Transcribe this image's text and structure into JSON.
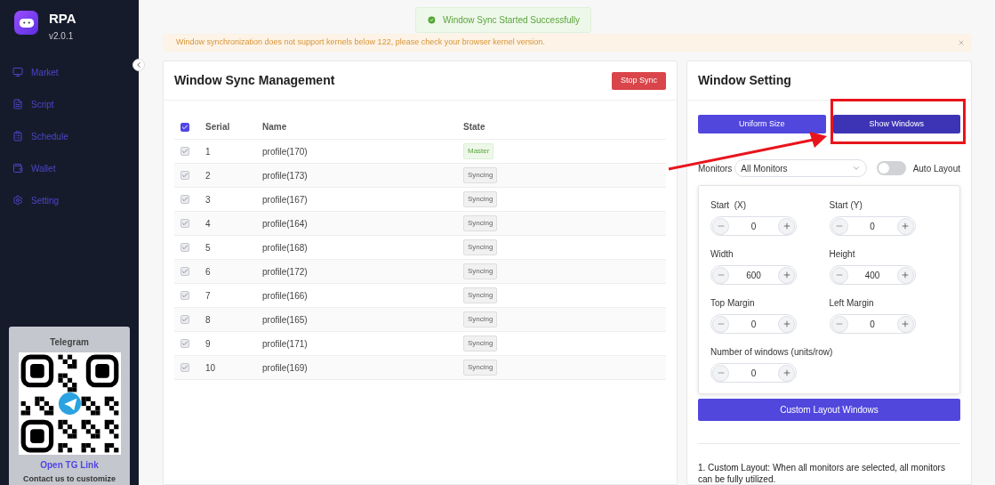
{
  "sidebar": {
    "app_name": "RPA",
    "version": "v2.0.1",
    "items": [
      {
        "label": "Market",
        "selected": false
      },
      {
        "label": "Script",
        "selected": false
      },
      {
        "label": "Schedule",
        "selected": false
      },
      {
        "label": "Wallet",
        "selected": false
      },
      {
        "label": "Setting",
        "selected": false
      }
    ],
    "promo": {
      "title": "Telegram",
      "link": "Open TG Link",
      "note": "Contact us to customize"
    }
  },
  "toast": {
    "text": "Window Sync Started Successfully"
  },
  "alert": {
    "text": "Window synchronization does not support kernels below 122, please check your browser kernel version."
  },
  "sync_panel": {
    "title": "Window Sync Management",
    "stop_button": "Stop Sync",
    "table": {
      "all_checked": true,
      "columns": [
        "Serial",
        "Name",
        "State"
      ],
      "rows": [
        {
          "serial": "1",
          "name": "profile(170)",
          "state": "Master",
          "kind": "master",
          "checked": true,
          "disabled": true
        },
        {
          "serial": "2",
          "name": "profile(173)",
          "state": "Syncing",
          "kind": "syncing",
          "checked": true,
          "disabled": true
        },
        {
          "serial": "3",
          "name": "profile(167)",
          "state": "Syncing",
          "kind": "syncing",
          "checked": true,
          "disabled": true
        },
        {
          "serial": "4",
          "name": "profile(164)",
          "state": "Syncing",
          "kind": "syncing",
          "checked": true,
          "disabled": true
        },
        {
          "serial": "5",
          "name": "profile(168)",
          "state": "Syncing",
          "kind": "syncing",
          "checked": true,
          "disabled": true
        },
        {
          "serial": "6",
          "name": "profile(172)",
          "state": "Syncing",
          "kind": "syncing",
          "checked": true,
          "disabled": true
        },
        {
          "serial": "7",
          "name": "profile(166)",
          "state": "Syncing",
          "kind": "syncing",
          "checked": true,
          "disabled": true
        },
        {
          "serial": "8",
          "name": "profile(165)",
          "state": "Syncing",
          "kind": "syncing",
          "checked": true,
          "disabled": true
        },
        {
          "serial": "9",
          "name": "profile(171)",
          "state": "Syncing",
          "kind": "syncing",
          "checked": true,
          "disabled": true
        },
        {
          "serial": "10",
          "name": "profile(169)",
          "state": "Syncing",
          "kind": "syncing",
          "checked": true,
          "disabled": true
        }
      ]
    }
  },
  "settings_panel": {
    "title": "Window Setting",
    "buttons": [
      {
        "label": "Uniform Size",
        "hovered": false,
        "annotated": false
      },
      {
        "label": "Show Windows",
        "hovered": true,
        "annotated": true
      }
    ],
    "monitors": {
      "label": "Monitors",
      "value": "All Monitors"
    },
    "auto_layout": {
      "label": "Auto Layout",
      "on": false
    },
    "fields": [
      {
        "label": "Start  (X)",
        "value": "0"
      },
      {
        "label": "Start (Y)",
        "value": "0"
      },
      {
        "label": "Width",
        "value": "600"
      },
      {
        "label": "Height",
        "value": "400"
      },
      {
        "label": "Top Margin",
        "value": "0"
      },
      {
        "label": "Left Margin",
        "value": "0"
      },
      {
        "label": "Number of windows (units/row)",
        "value": "0"
      }
    ],
    "custom_button": "Custom Layout Windows",
    "note": "1. Custom Layout: When all monitors are selected, all monitors can be fully utilized."
  }
}
